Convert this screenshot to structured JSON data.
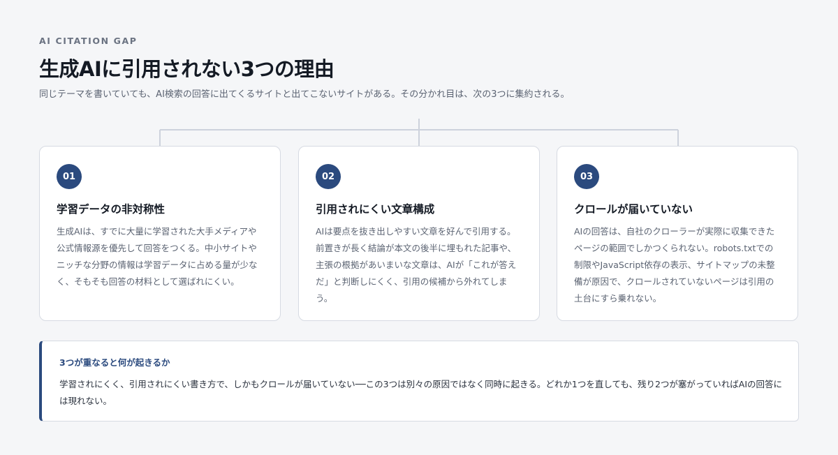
{
  "header": {
    "eyebrow": "AI CITATION GAP",
    "title": "生成AIに引用されない3つの理由",
    "subtitle": "同じテーマを書いていても、AI検索の回答に出てくるサイトと出てこないサイトがある。その分かれ目は、次の3つに集約される。"
  },
  "cards": [
    {
      "number": "01",
      "title": "学習データの非対称性",
      "body": "生成AIは、すでに大量に学習された大手メディアや公式情報源を優先して回答をつくる。中小サイトやニッチな分野の情報は学習データに占める量が少なく、そもそも回答の材料として選ばれにくい。"
    },
    {
      "number": "02",
      "title": "引用されにくい文章構成",
      "body": "AIは要点を抜き出しやすい文章を好んで引用する。前置きが長く結論が本文の後半に埋もれた記事や、主張の根拠があいまいな文章は、AIが「これが答えだ」と判断しにくく、引用の候補から外れてしまう。"
    },
    {
      "number": "03",
      "title": "クロールが届いていない",
      "body": "AIの回答は、自社のクローラーが実際に収集できたページの範囲でしかつくられない。robots.txtでの制限やJavaScript依存の表示、サイトマップの未整備が原因で、クロールされていないページは引用の土台にすら乗れない。"
    }
  ],
  "callout": {
    "title": "3つが重なると何が起きるか",
    "body": "学習されにくく、引用されにくい書き方で、しかもクロールが届いていない──この3つは別々の原因ではなく同時に起きる。どれか1つを直しても、残り2つが塞がっていればAIの回答には現れない。"
  },
  "colors": {
    "accent": "#2b4a7e",
    "background": "#f5f6f8",
    "card": "#ffffff",
    "border": "#d6dae2",
    "connector": "#cdd2dc"
  }
}
